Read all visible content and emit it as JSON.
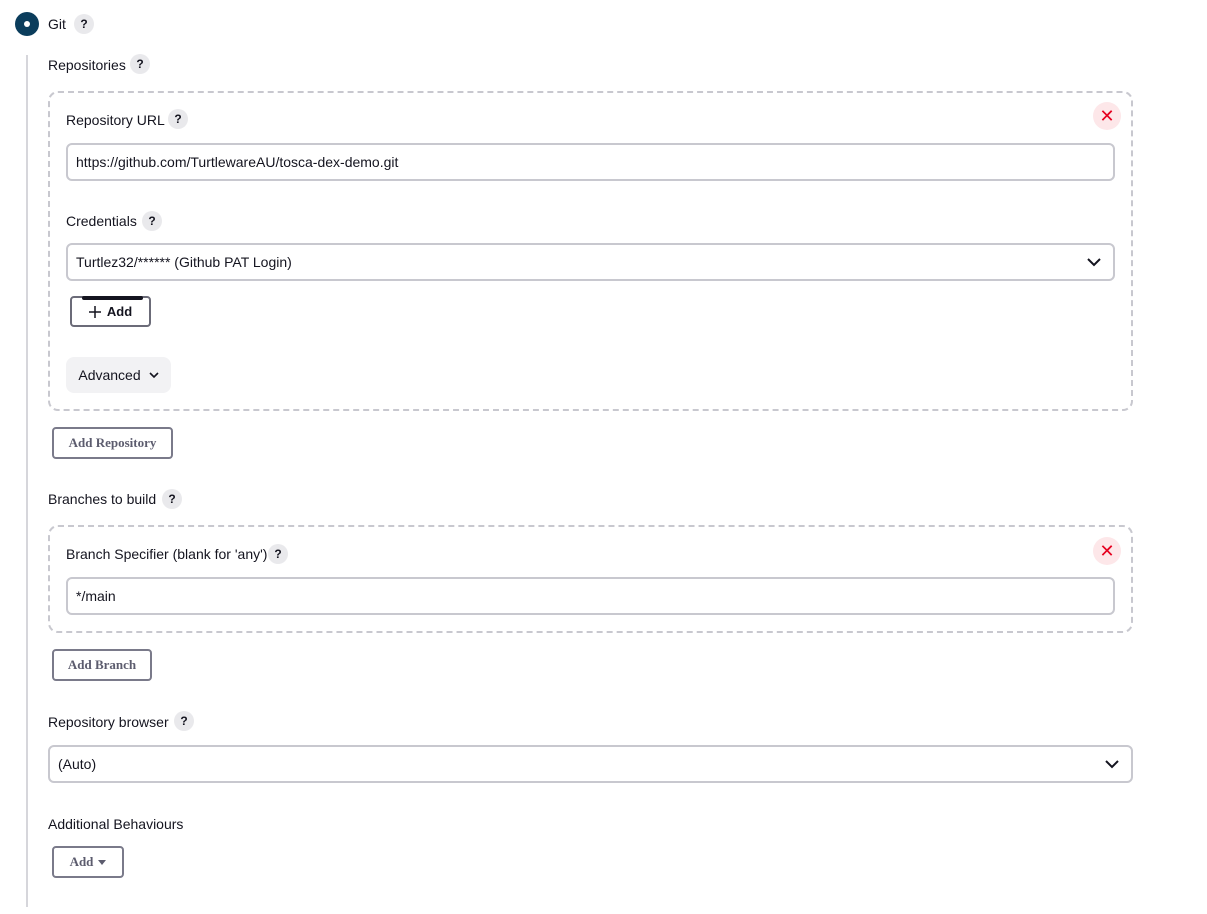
{
  "scm": {
    "git_label": "Git"
  },
  "repositories": {
    "label": "Repositories",
    "repository_url_label": "Repository URL",
    "repository_url_value": "https://github.com/TurtlewareAU/tosca-dex-demo.git",
    "credentials_label": "Credentials",
    "credentials_value": "Turtlez32/****** (Github PAT Login)",
    "add_credentials_label": "Add",
    "advanced_label": "Advanced",
    "add_repository_label": "Add Repository"
  },
  "branches": {
    "label": "Branches to build",
    "specifier_label": "Branch Specifier (blank for 'any')",
    "specifier_value": "*/main",
    "add_branch_label": "Add Branch"
  },
  "repository_browser": {
    "label": "Repository browser",
    "value": "(Auto)"
  },
  "additional_behaviours": {
    "label": "Additional Behaviours",
    "add_label": "Add"
  },
  "help_glyph": "?",
  "close_glyph": "✕",
  "colors": {
    "accent": "#0b3d5c",
    "danger": "#e6001f",
    "danger_bg": "#fde7e9"
  }
}
